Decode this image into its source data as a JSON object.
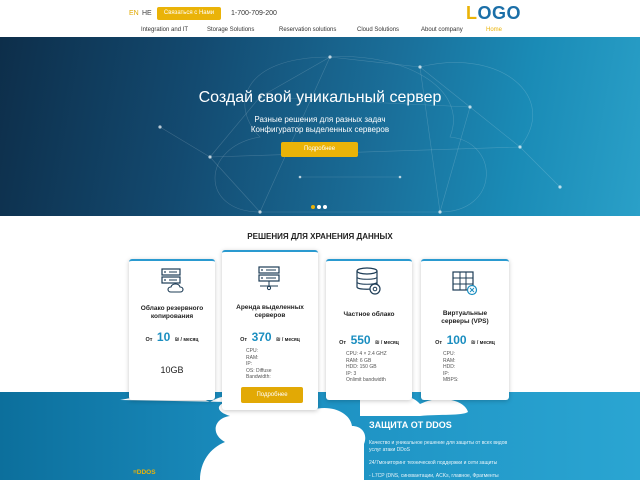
{
  "header": {
    "lang_en": "EN",
    "lang_he": "HE",
    "contact_button": "Связаться с Нами",
    "phone": "1-700-709-200",
    "logo_first": "L",
    "logo_rest": "OGO"
  },
  "nav": [
    {
      "label": "Integration and IT"
    },
    {
      "label": "Storage Solutions"
    },
    {
      "label": "Reservation solutions"
    },
    {
      "label": "Cloud Solutions"
    },
    {
      "label": "About company"
    },
    {
      "label": "Home",
      "active": true
    }
  ],
  "hero": {
    "title": "Создай свой уникальный сервер",
    "subtitle_1": "Разные решения для разных задач",
    "subtitle_2": "Конфигуратор выделенных серверов",
    "button": "Подробнее",
    "slides": 3,
    "active_slide": 1
  },
  "storage": {
    "title": "РЕШЕНИЯ ДЛЯ ХРАНЕНИЯ ДАННЫХ",
    "cards": [
      {
        "icon": "cloud-server-icon",
        "title": "Облако резервного копирования",
        "from": "От",
        "price": "10",
        "unit": "₪ / месяц",
        "extra": "10GB"
      },
      {
        "icon": "server-rack-icon",
        "title": "Аренда выделенных серверов",
        "from": "От",
        "price": "370",
        "unit": "₪ / месяц",
        "specs": [
          "CPU:",
          "RAM:",
          "IP:",
          "OS: Diffuse",
          "Bandwidth:"
        ],
        "button": "Подробнее"
      },
      {
        "icon": "database-gear-icon",
        "title": "Частное облако",
        "from": "От",
        "price": "550",
        "unit": "₪ / месяц",
        "specs": [
          "CPU: 4 × 2.4 GHZ",
          "RAM: 6 GB",
          "HDD: 150 GB",
          "IP: 3",
          "Onlimit bandwidth"
        ]
      },
      {
        "icon": "virtual-server-icon",
        "title": "Виртуальные серверы (VPS)",
        "from": "От",
        "price": "100",
        "unit": "₪ / месяц",
        "specs": [
          "CPU:",
          "RAM:",
          "HDD:",
          "IP:",
          "MBPS:"
        ]
      }
    ]
  },
  "ddos": {
    "title": "ЗАЩИТА ОТ DDOS",
    "line_1": "Качество и уникальное решение для защиты от всех видов",
    "line_2": "услуг атаки DDoS",
    "line_3": "24/7мониторинг технической поддержки и сети защиты",
    "line_4": "- L7CP (DNS, синхвантации, ACKs, главное, Фрагменты",
    "tag": "DDOS"
  },
  "colors": {
    "accent": "#eab308",
    "primary": "#1b8ec0",
    "hero_dark": "#0d2e4a"
  }
}
